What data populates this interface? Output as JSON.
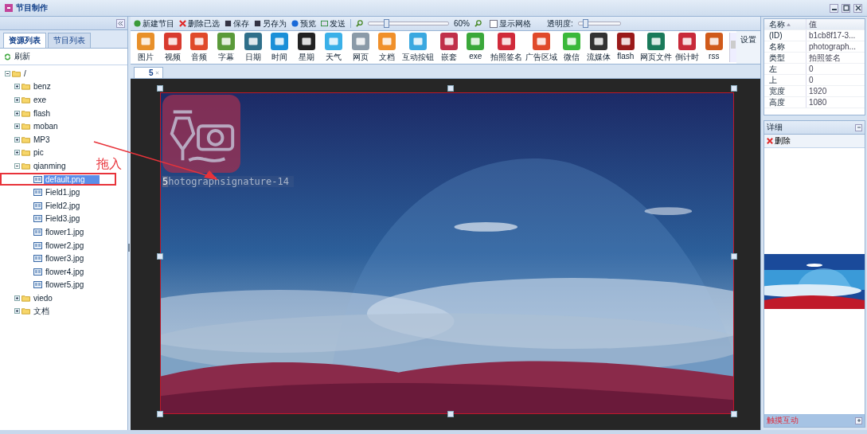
{
  "window": {
    "title": "节目制作"
  },
  "left_panel": {
    "tabs": [
      {
        "label": "资源列表",
        "selected": true
      },
      {
        "label": "节目列表",
        "selected": false
      }
    ],
    "refresh": "刷新",
    "tree": [
      {
        "label": "/",
        "kind": "folder",
        "expanded": true,
        "selected": false,
        "children": [
          {
            "label": "benz",
            "kind": "folder",
            "expanded": false,
            "selected": false
          },
          {
            "label": "exe",
            "kind": "folder",
            "expanded": false,
            "selected": false
          },
          {
            "label": "flash",
            "kind": "folder",
            "expanded": false,
            "selected": false
          },
          {
            "label": "moban",
            "kind": "folder",
            "expanded": false,
            "selected": false
          },
          {
            "label": "MP3",
            "kind": "folder",
            "expanded": false,
            "selected": false
          },
          {
            "label": "pic",
            "kind": "folder",
            "expanded": false,
            "selected": false
          },
          {
            "label": "qianming",
            "kind": "folder",
            "expanded": true,
            "selected": false,
            "children": [
              {
                "label": "default.png",
                "kind": "file",
                "selected": true
              },
              {
                "label": "Field1.jpg",
                "kind": "file",
                "selected": false
              },
              {
                "label": "Field2.jpg",
                "kind": "file",
                "selected": false
              },
              {
                "label": "Field3.jpg",
                "kind": "file",
                "selected": false
              },
              {
                "label": "flower1.jpg",
                "kind": "file",
                "selected": false
              },
              {
                "label": "flower2.jpg",
                "kind": "file",
                "selected": false
              },
              {
                "label": "flower3.jpg",
                "kind": "file",
                "selected": false
              },
              {
                "label": "flower4.jpg",
                "kind": "file",
                "selected": false
              },
              {
                "label": "flower5.jpg",
                "kind": "file",
                "selected": false
              }
            ]
          },
          {
            "label": "viedo",
            "kind": "folder",
            "expanded": false,
            "selected": false
          },
          {
            "label": "文档",
            "kind": "folder",
            "expanded": false,
            "selected": false
          }
        ]
      }
    ]
  },
  "annotation": {
    "text": "拖入"
  },
  "toolbar": {
    "buttons": [
      {
        "label": "新建节目",
        "kind": "new"
      },
      {
        "label": "删除已选",
        "kind": "delete"
      },
      {
        "label": "保存",
        "kind": "save"
      },
      {
        "label": "另存为",
        "kind": "saveas"
      },
      {
        "label": "预览",
        "kind": "preview"
      },
      {
        "label": "发送",
        "kind": "send"
      }
    ],
    "zoom": {
      "level": 0.22,
      "reading": "60%"
    },
    "grid": {
      "label": "显示网格",
      "checked": false
    },
    "opacity": {
      "label": "透明度:",
      "level": 0.15
    }
  },
  "palette": [
    {
      "label": "图片",
      "color": "#e8902a"
    },
    {
      "label": "视频",
      "color": "#d83a2e"
    },
    {
      "label": "音频",
      "color": "#e04a2a"
    },
    {
      "label": "字幕",
      "color": "#5a9a3a"
    },
    {
      "label": "日期",
      "color": "#2f6f8a"
    },
    {
      "label": "时间",
      "color": "#1a8fd8"
    },
    {
      "label": "星期",
      "color": "#222222"
    },
    {
      "label": "天气",
      "color": "#3ab0e8"
    },
    {
      "label": "网页",
      "color": "#8a9aa8"
    },
    {
      "label": "文档",
      "color": "#f0902a"
    },
    {
      "label": "互动按钮",
      "color": "#3aa8e0"
    },
    {
      "label": "嵌套",
      "color": "#c0304a"
    },
    {
      "label": "exe",
      "color": "#3aa83a"
    },
    {
      "label": "拍照签名",
      "color": "#d02a3a"
    },
    {
      "label": "广告区域",
      "color": "#e04a2a"
    },
    {
      "label": "微信",
      "color": "#3ab83a"
    },
    {
      "label": "流媒体",
      "color": "#333333"
    },
    {
      "label": "flash",
      "color": "#9a1a1a"
    },
    {
      "label": "网页文件",
      "color": "#1a7a5a"
    },
    {
      "label": "倒计时",
      "color": "#c82a3a"
    },
    {
      "label": "rss",
      "color": "#d05a1a"
    }
  ],
  "settings": "设置",
  "doc_tabs": [
    {
      "label": "5",
      "selected": true
    }
  ],
  "stage": {
    "element_number": "5",
    "element_label": "hotographsignature-14"
  },
  "properties": {
    "columns": [
      "名称",
      "值"
    ],
    "rows": [
      {
        "name": "(ID)",
        "value": "b1cb8f17-3..."
      },
      {
        "name": "名称",
        "value": "photograph..."
      },
      {
        "name": "类型",
        "value": "拍照签名"
      },
      {
        "name": "左",
        "value": "0"
      },
      {
        "name": "上",
        "value": "0"
      },
      {
        "name": "宽度",
        "value": "1920"
      },
      {
        "name": "高度",
        "value": "1080"
      }
    ]
  },
  "detail": {
    "title": "详细",
    "delete": "删除"
  },
  "touch_panel": {
    "title": "触摸互动"
  }
}
